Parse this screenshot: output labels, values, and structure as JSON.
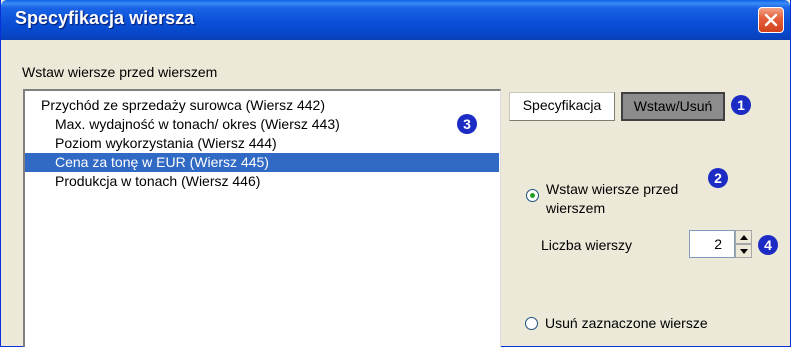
{
  "window": {
    "title": "Specyfikacja wiersza"
  },
  "list": {
    "label": "Wstaw wiersze przed wierszem",
    "items": [
      {
        "text": "Przychód ze sprzedaży surowca (Wiersz 442)",
        "level": 0,
        "selected": false
      },
      {
        "text": "Max. wydajność w tonach/ okres (Wiersz 443)",
        "level": 1,
        "selected": false
      },
      {
        "text": "Poziom wykorzystania (Wiersz 444)",
        "level": 1,
        "selected": false
      },
      {
        "text": "Cena za tonę w EUR (Wiersz 445)",
        "level": 1,
        "selected": true
      },
      {
        "text": "Produkcja w tonach (Wiersz 446)",
        "level": 1,
        "selected": false
      }
    ]
  },
  "tabs": {
    "spec_label": "Specyfikacja",
    "insert_delete_label": "Wstaw/Usuń"
  },
  "options": {
    "insert_label": "Wstaw wiersze przed wierszem",
    "insert_checked": true,
    "delete_label": "Usuń zaznaczone wiersze",
    "delete_checked": false
  },
  "row_count": {
    "label": "Liczba wierszy",
    "value": "2"
  },
  "badges": {
    "one": "❶",
    "two": "❷",
    "three": "❸",
    "four": "❹"
  },
  "colors": {
    "selection": "#316ac5",
    "badge": "#1b2bc4",
    "title_bar": "#0a50d8"
  }
}
